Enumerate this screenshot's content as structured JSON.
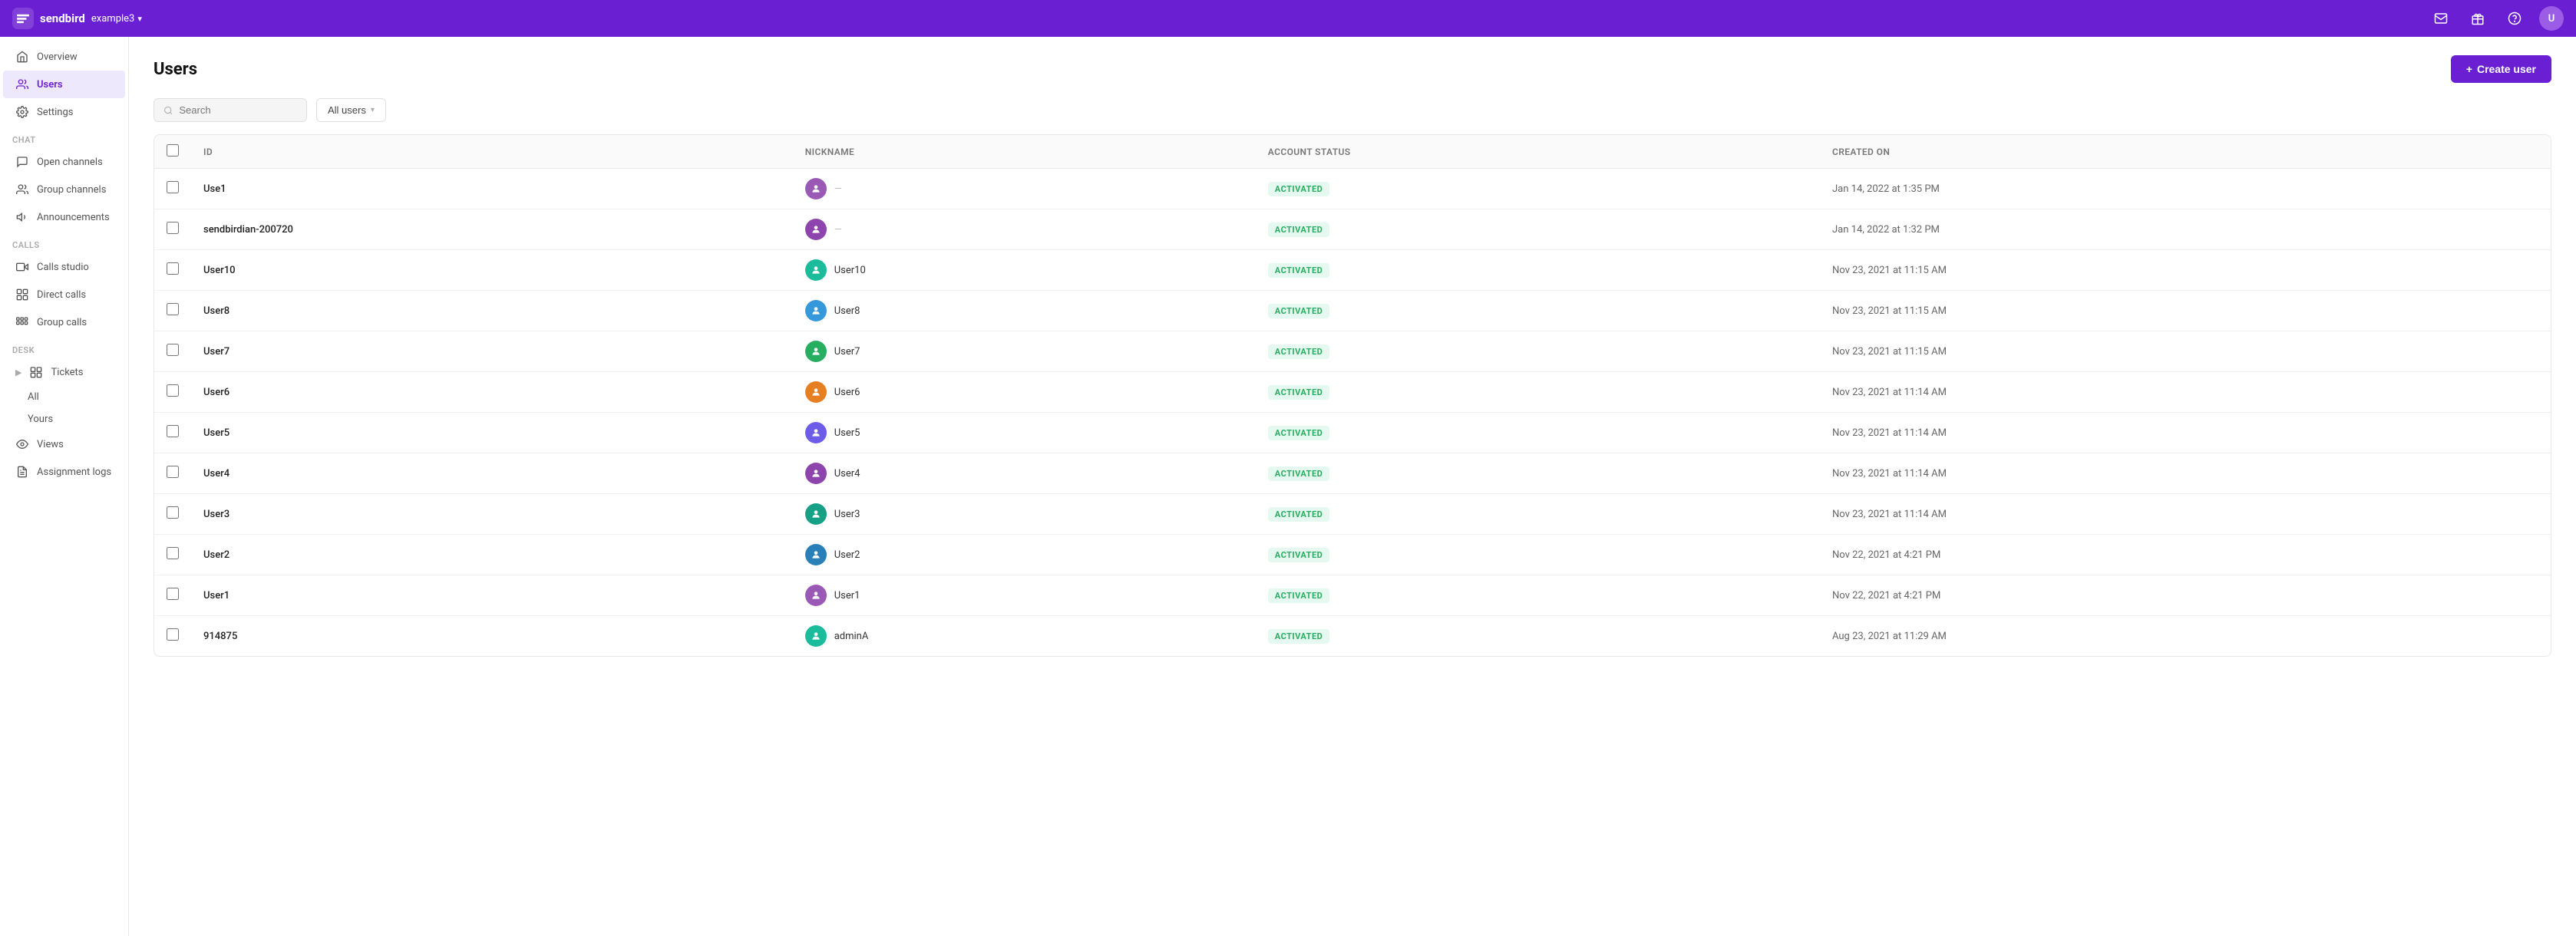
{
  "topnav": {
    "logo_text": "sendbird",
    "app_name": "example3",
    "chevron": "▾",
    "mail_icon": "✉",
    "gift_icon": "🎁",
    "help_icon": "?",
    "avatar_initials": "U"
  },
  "sidebar": {
    "overview_label": "Overview",
    "users_label": "Users",
    "settings_label": "Settings",
    "chat_section": "Chat",
    "open_channels_label": "Open channels",
    "group_channels_label": "Group channels",
    "announcements_label": "Announcements",
    "calls_section": "Calls",
    "calls_studio_label": "Calls studio",
    "direct_calls_label": "Direct calls",
    "group_calls_label": "Group calls",
    "desk_section": "Desk",
    "tickets_label": "Tickets",
    "all_label": "All",
    "yours_label": "Yours",
    "views_label": "Views",
    "assignment_logs_label": "Assignment logs"
  },
  "page": {
    "title": "Users",
    "create_user_btn": "Create user",
    "create_user_plus": "+"
  },
  "toolbar": {
    "search_placeholder": "Search",
    "filter_label": "All users",
    "filter_chevron": "▾"
  },
  "table": {
    "col_id": "ID",
    "col_nickname": "Nickname",
    "col_account_status": "Account status",
    "col_created_on": "Created on",
    "rows": [
      {
        "id": "Use1",
        "nickname": "--",
        "avatar_color": "#9B59B6",
        "avatar_icon": "💬",
        "status": "ACTIVATED",
        "created_on": "Jan 14, 2022 at 1:35 PM"
      },
      {
        "id": "sendbirdian-200720",
        "nickname": "--",
        "avatar_color": "#8E44AD",
        "avatar_icon": "💬",
        "status": "ACTIVATED",
        "created_on": "Jan 14, 2022 at 1:32 PM"
      },
      {
        "id": "User10",
        "nickname": "User10",
        "avatar_color": "#1ABC9C",
        "avatar_icon": "👤",
        "status": "ACTIVATED",
        "created_on": "Nov 23, 2021 at 11:15 AM"
      },
      {
        "id": "User8",
        "nickname": "User8",
        "avatar_color": "#3498DB",
        "avatar_icon": "👤",
        "status": "ACTIVATED",
        "created_on": "Nov 23, 2021 at 11:15 AM"
      },
      {
        "id": "User7",
        "nickname": "User7",
        "avatar_color": "#2ECC71",
        "avatar_icon": "🌐",
        "status": "ACTIVATED",
        "created_on": "Nov 23, 2021 at 11:15 AM"
      },
      {
        "id": "User6",
        "nickname": "User6",
        "avatar_color": "#E67E22",
        "avatar_icon": "👤",
        "status": "ACTIVATED",
        "created_on": "Nov 23, 2021 at 11:14 AM"
      },
      {
        "id": "User5",
        "nickname": "User5",
        "avatar_color": "#6C5CE7",
        "avatar_icon": "👤",
        "status": "ACTIVATED",
        "created_on": "Nov 23, 2021 at 11:14 AM"
      },
      {
        "id": "User4",
        "nickname": "User4",
        "avatar_color": "#8E44AD",
        "avatar_icon": "💬",
        "status": "ACTIVATED",
        "created_on": "Nov 23, 2021 at 11:14 AM"
      },
      {
        "id": "User3",
        "nickname": "User3",
        "avatar_color": "#16A085",
        "avatar_icon": "👤",
        "status": "ACTIVATED",
        "created_on": "Nov 23, 2021 at 11:14 AM"
      },
      {
        "id": "User2",
        "nickname": "User2",
        "avatar_color": "#2980B9",
        "avatar_icon": "👤",
        "status": "ACTIVATED",
        "created_on": "Nov 22, 2021 at 4:21 PM"
      },
      {
        "id": "User1",
        "nickname": "User1",
        "avatar_color": "#8E44AD",
        "avatar_icon": "👤",
        "status": "ACTIVATED",
        "created_on": "Nov 22, 2021 at 4:21 PM"
      },
      {
        "id": "914875",
        "nickname": "adminA",
        "avatar_color": "#1ABC9C",
        "avatar_icon": "👤",
        "status": "ACTIVATED",
        "created_on": "Aug 23, 2021 at 11:29 AM"
      }
    ]
  }
}
